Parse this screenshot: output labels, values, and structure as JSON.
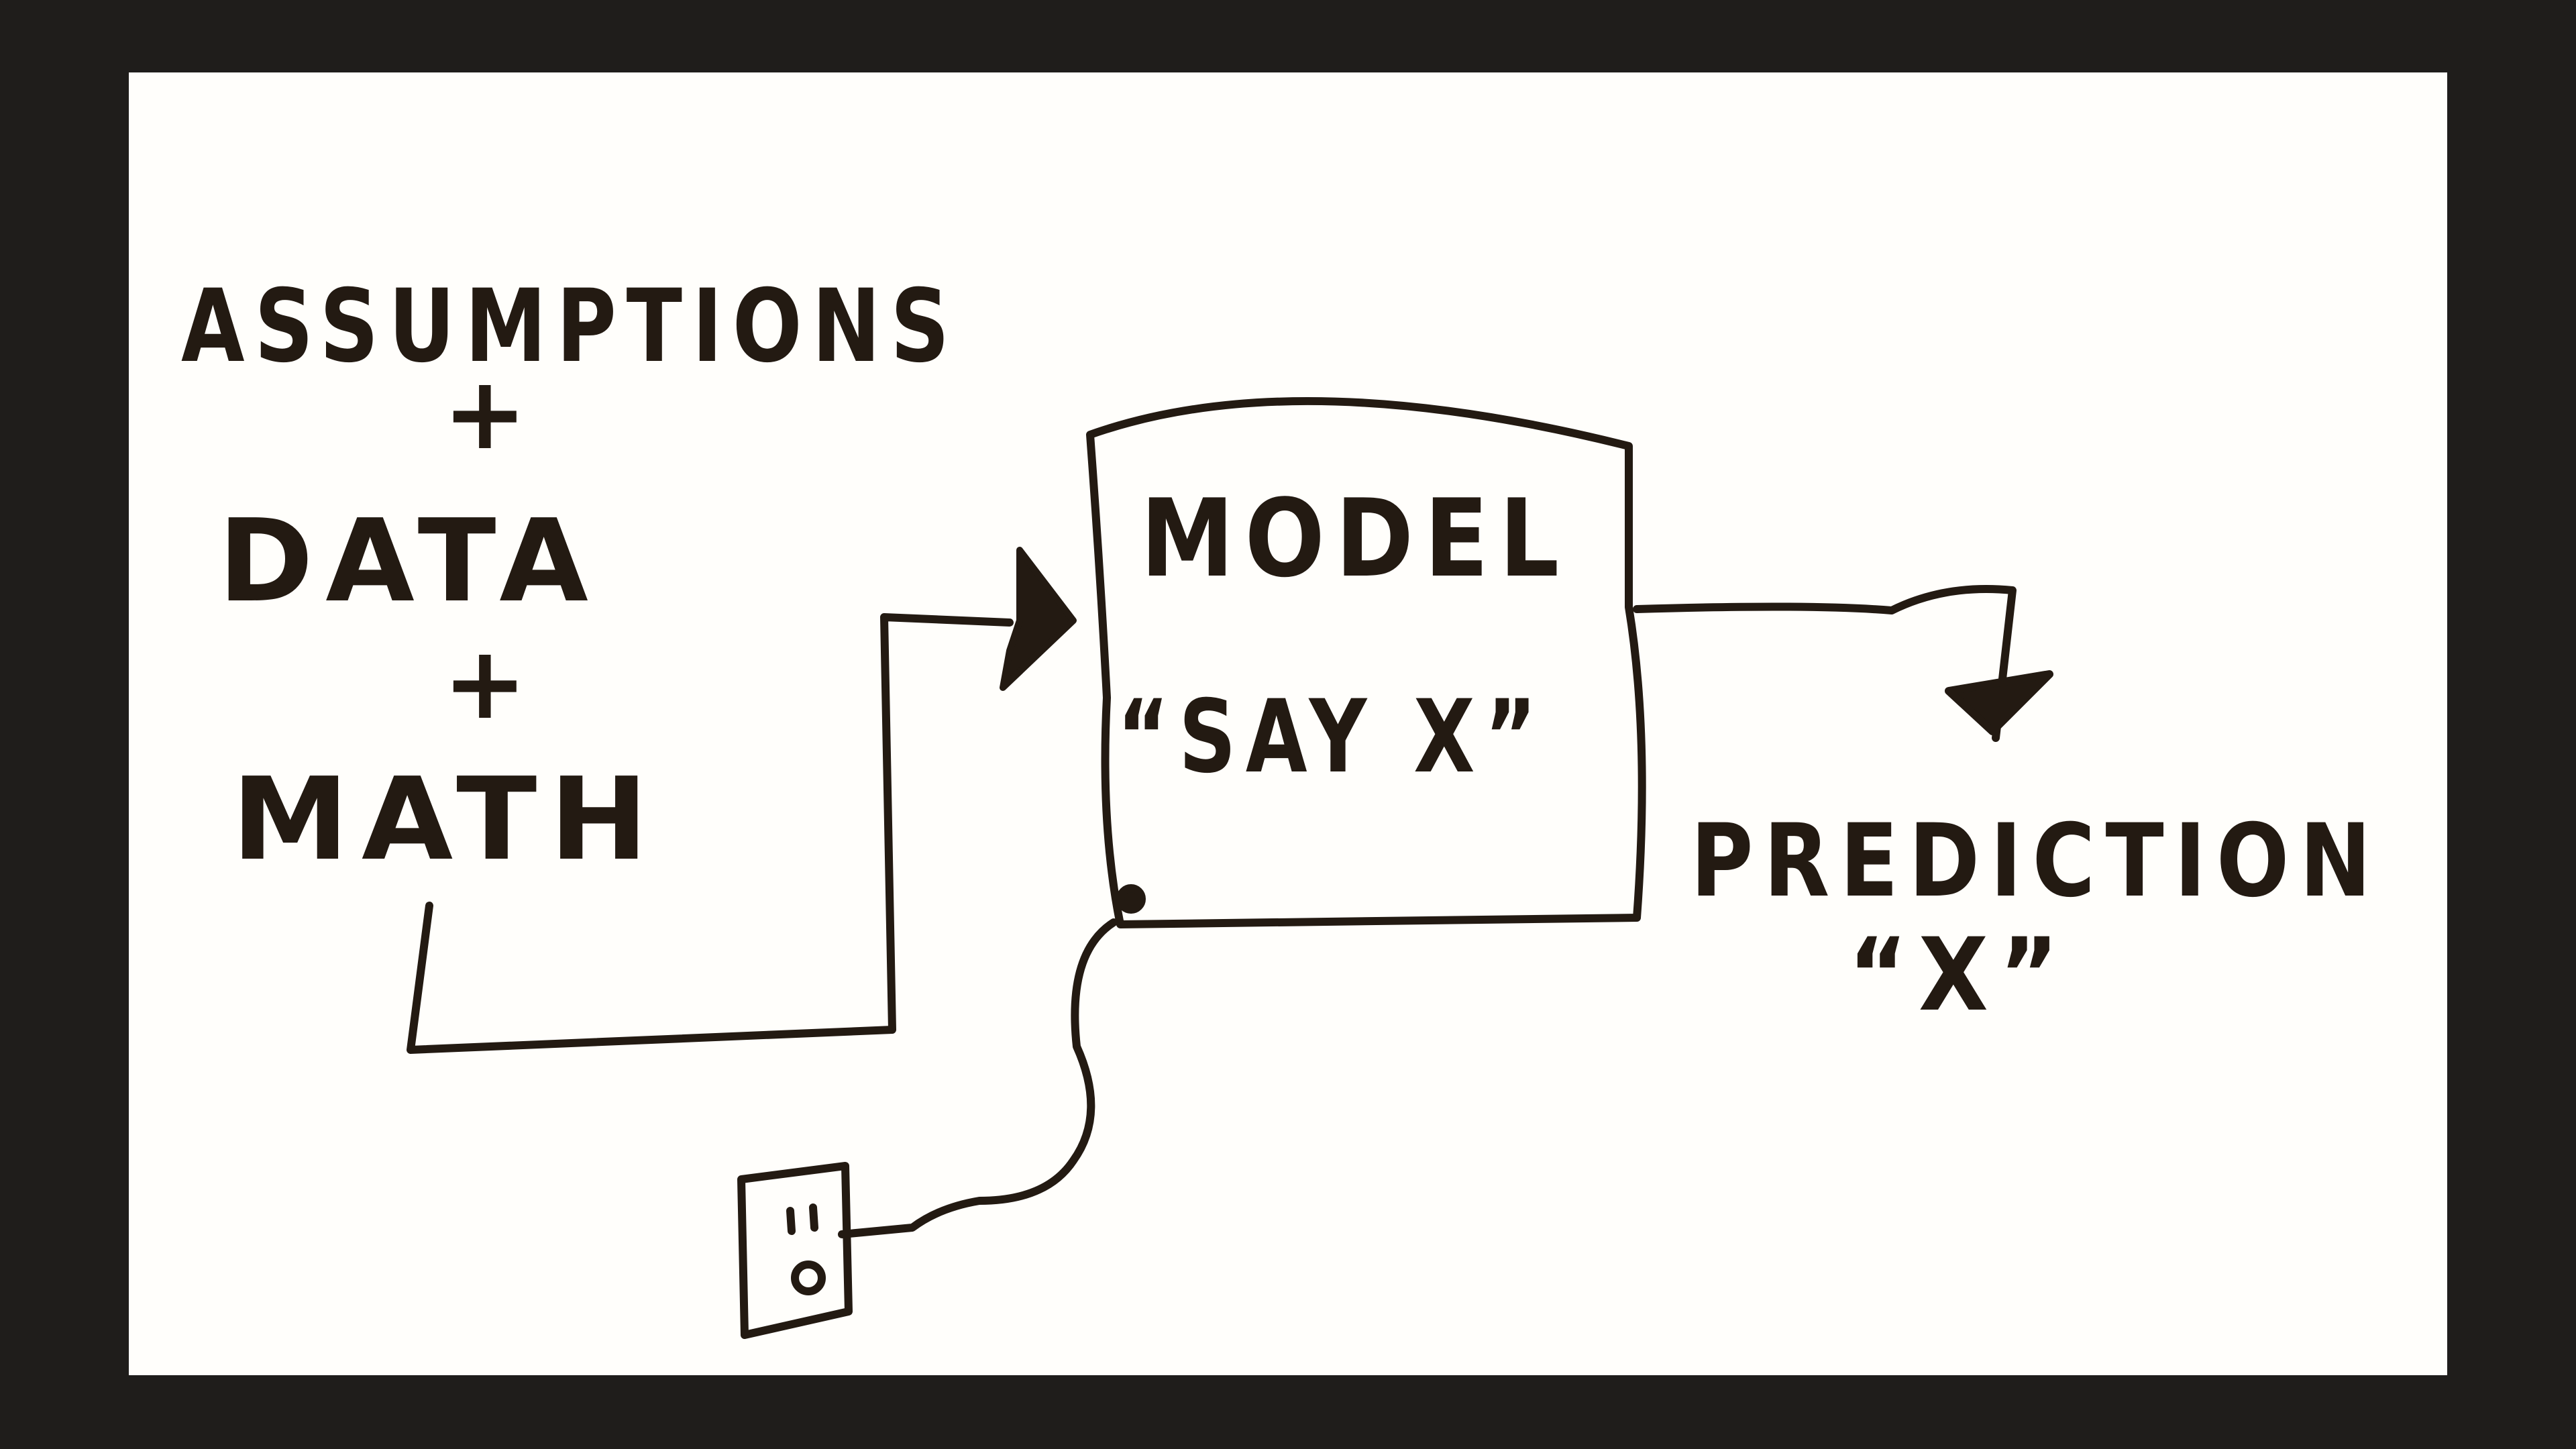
{
  "diagram": {
    "inputs": {
      "assumptions": "ASSUMPTIONS",
      "plus_1": "+",
      "data": "DATA",
      "plus_2": "+",
      "math": "MATH"
    },
    "model": {
      "title": "MODEL",
      "instruction": "“SAY X”"
    },
    "output": {
      "label": "PREDICTION",
      "value": "“X”"
    },
    "power": {
      "icon": "wall-outlet-icon"
    }
  },
  "colors": {
    "ink": "#231a12",
    "paper": "#fffefb",
    "letterbox": "#1f1d1b"
  }
}
